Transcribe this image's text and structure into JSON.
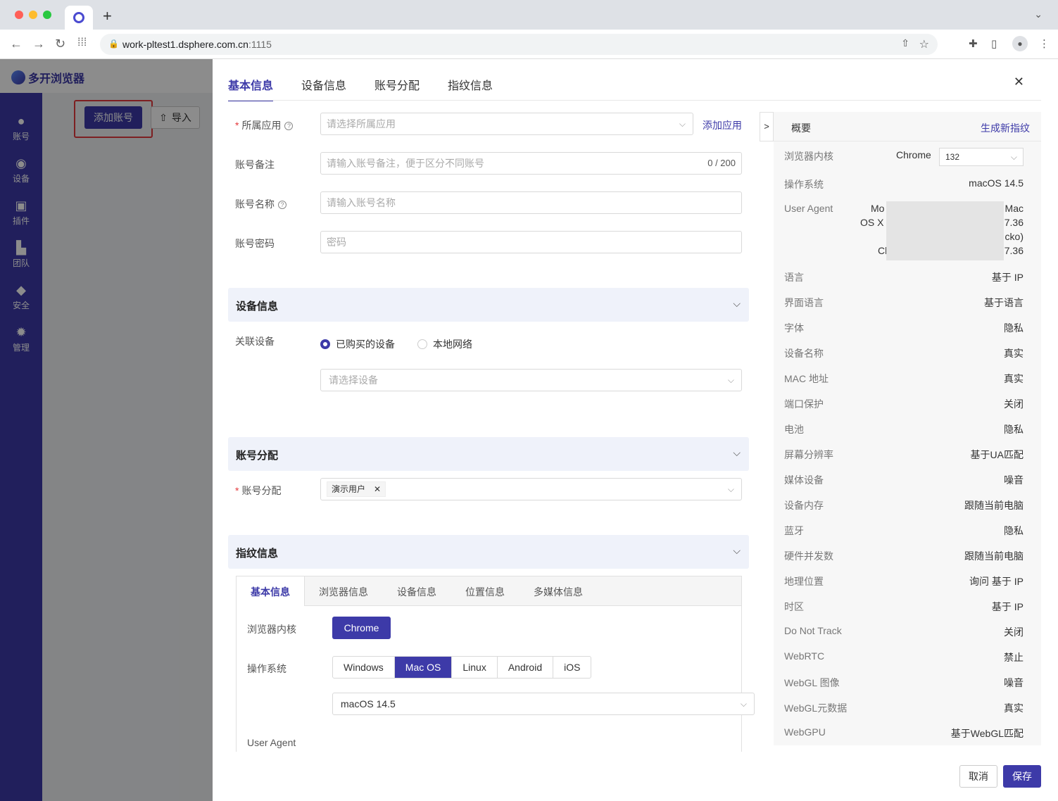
{
  "browser": {
    "url_host": "work-pltest1.dsphere.com.cn",
    "url_port": ":1115"
  },
  "app": {
    "brand": "多开浏览器",
    "sidebar": [
      {
        "label": "账号",
        "icon": "user-icon"
      },
      {
        "label": "设备",
        "icon": "wifi-icon"
      },
      {
        "label": "插件",
        "icon": "plugin-icon"
      },
      {
        "label": "团队",
        "icon": "team-icon"
      },
      {
        "label": "安全",
        "icon": "shield-icon"
      },
      {
        "label": "管理",
        "icon": "gear-icon"
      }
    ],
    "add_account": "添加账号",
    "import": "导入"
  },
  "drawer": {
    "tabs": [
      "基本信息",
      "设备信息",
      "账号分配",
      "指纹信息"
    ],
    "form": {
      "app_label": "所属应用",
      "app_placeholder": "请选择所属应用",
      "add_app": "添加应用",
      "note_label": "账号备注",
      "note_placeholder": "请输入账号备注，便于区分不同账号",
      "note_count": "0 / 200",
      "name_label": "账号名称",
      "name_placeholder": "请输入账号名称",
      "pwd_label": "账号密码",
      "pwd_placeholder": "密码"
    },
    "device": {
      "title": "设备信息",
      "assoc_label": "关联设备",
      "opt_bought": "已购买的设备",
      "opt_local": "本地网络",
      "select_placeholder": "请选择设备"
    },
    "assign": {
      "title": "账号分配",
      "label": "账号分配",
      "tag": "演示用户"
    },
    "fingerprint": {
      "title": "指纹信息",
      "tabs": [
        "基本信息",
        "浏览器信息",
        "设备信息",
        "位置信息",
        "多媒体信息"
      ],
      "kernel_label": "浏览器内核",
      "kernel_value": "Chrome",
      "os_label": "操作系统",
      "os_options": [
        "Windows",
        "Mac OS",
        "Linux",
        "Android",
        "iOS"
      ],
      "os_selected": "Mac OS",
      "os_version": "macOS 14.5",
      "ua_label": "User Agent"
    },
    "cancel": "取消",
    "save": "保存"
  },
  "summary": {
    "toggle": ">",
    "title": "概要",
    "generate": "生成新指纹",
    "kernel_label": "浏览器内核",
    "kernel_value": "Chrome",
    "kernel_version": "132",
    "os_label": "操作系统",
    "os_value": "macOS 14.5",
    "ua_label": "User Agent",
    "ua_fragments": [
      "Mo",
      "Mac",
      "OS X",
      "7.36",
      "cko)",
      "Cl",
      "7.36"
    ],
    "rows": [
      {
        "k": "语言",
        "v": "基于 IP"
      },
      {
        "k": "界面语言",
        "v": "基于语言"
      },
      {
        "k": "字体",
        "v": "隐私"
      },
      {
        "k": "设备名称",
        "v": "真实"
      },
      {
        "k": "MAC 地址",
        "v": "真实"
      },
      {
        "k": "端口保护",
        "v": "关闭"
      },
      {
        "k": "电池",
        "v": "隐私"
      },
      {
        "k": "屏幕分辨率",
        "v": "基于UA匹配"
      },
      {
        "k": "媒体设备",
        "v": "噪音"
      },
      {
        "k": "设备内存",
        "v": "跟随当前电脑"
      },
      {
        "k": "蓝牙",
        "v": "隐私"
      },
      {
        "k": "硬件并发数",
        "v": "跟随当前电脑"
      },
      {
        "k": "地理位置",
        "v": "询问 基于 IP"
      },
      {
        "k": "时区",
        "v": "基于 IP"
      },
      {
        "k": "Do Not Track",
        "v": "关闭"
      },
      {
        "k": "WebRTC",
        "v": "禁止"
      },
      {
        "k": "WebGL 图像",
        "v": "噪音"
      },
      {
        "k": "WebGL元数据",
        "v": "真实"
      },
      {
        "k": "WebGPU",
        "v": "基于WebGL匹配"
      }
    ]
  }
}
